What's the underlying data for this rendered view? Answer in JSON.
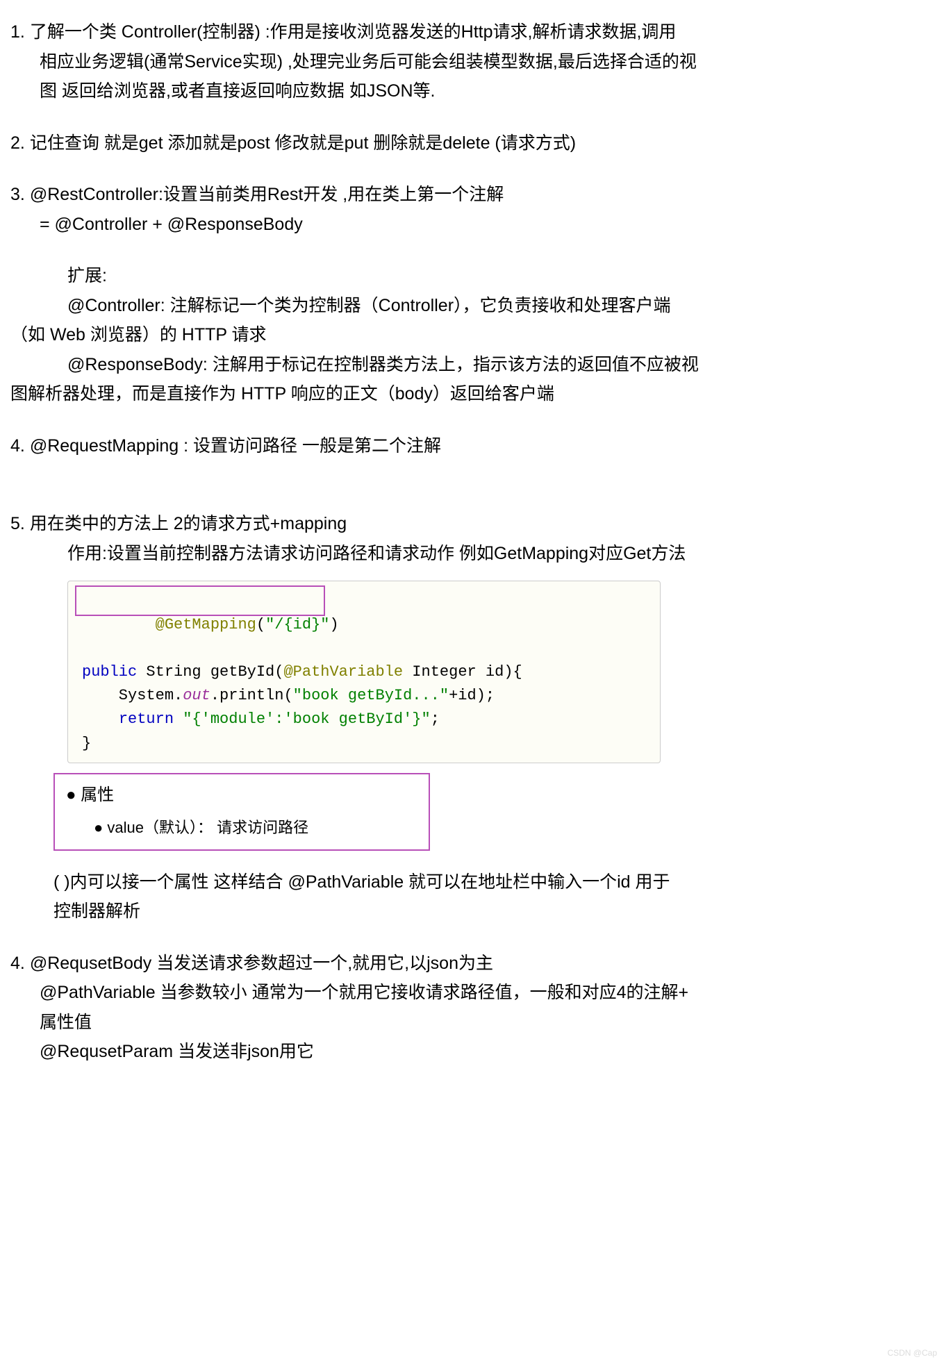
{
  "items": {
    "n1": {
      "num": "1.",
      "l1": "了解一个类 Controller(控制器)  :作用是接收浏览器发送的Http请求,解析请求数据,调用",
      "l2": "相应业务逻辑(通常Service实现) ,处理完业务后可能会组装模型数据,最后选择合适的视",
      "l3": "图 返回给浏览器,或者直接返回响应数据 如JSON等."
    },
    "n2": {
      "num": "2.",
      "text": "记住查询 就是get  添加就是post   修改就是put 删除就是delete    (请求方式)"
    },
    "n3": {
      "num": "3.",
      "l1": "@RestController:设置当前类用Rest开发 ,用在类上第一个注解",
      "l2": "= @Controller + @ResponseBody",
      "ext_label": "扩展:",
      "ext_c1": "@Controller: 注解标记一个类为控制器（Controller），它负责接收和处理客户端",
      "ext_c1b": "（如 Web 浏览器）的 HTTP 请求",
      "ext_r1": "@ResponseBody: 注解用于标记在控制器类方法上，指示该方法的返回值不应被视",
      "ext_r1b": "图解析器处理，而是直接作为 HTTP 响应的正文（body）返回给客户端"
    },
    "n4": {
      "num": "4.",
      "text": "@RequestMapping : 设置访问路径    一般是第二个注解"
    },
    "n5": {
      "num": "5.",
      "l1": "用在类中的方法上 2的请求方式+mapping",
      "l2": "作用:设置当前控制器方法请求访问路径和请求动作 例如GetMapping对应Get方法"
    },
    "code": {
      "l1_anno": "@GetMapping",
      "l1_paren_open": "(",
      "l1_str": "\"/{id}\"",
      "l1_paren_close": ")",
      "l2_kw": "public",
      "l2_type": " String ",
      "l2_method": "getById",
      "l2_po": "(",
      "l2_anno": "@PathVariable",
      "l2_type2": " Integer id",
      "l2_pc": "){",
      "l3_indent": "    System.",
      "l3_out": "out",
      "l3_print": ".println(",
      "l3_str": "\"book getById...\"",
      "l3_plus": "+id);",
      "l4_indent": "    ",
      "l4_kw": "return",
      "l4_sp": " ",
      "l4_str": "\"{'module':'book getById'}\"",
      "l4_semi": ";",
      "l5": "}"
    },
    "attr": {
      "l1": "● 属性",
      "l2": "● value（默认）： 请求访问路径"
    },
    "after": {
      "l1": "(   )内可以接一个属性  这样结合 @PathVariable 就可以在地址栏中输入一个id 用于",
      "l2": "控制器解析"
    },
    "n6": {
      "num": "4.",
      "l1": "@RequsetBody 当发送请求参数超过一个,就用它,以json为主",
      "l2": "@PathVariable 当参数较小 通常为一个就用它接收请求路径值，一般和对应4的注解+",
      "l3": "属性值",
      "l4": "@RequsetParam 当发送非json用它"
    }
  },
  "watermark": "CSDN @Cap"
}
